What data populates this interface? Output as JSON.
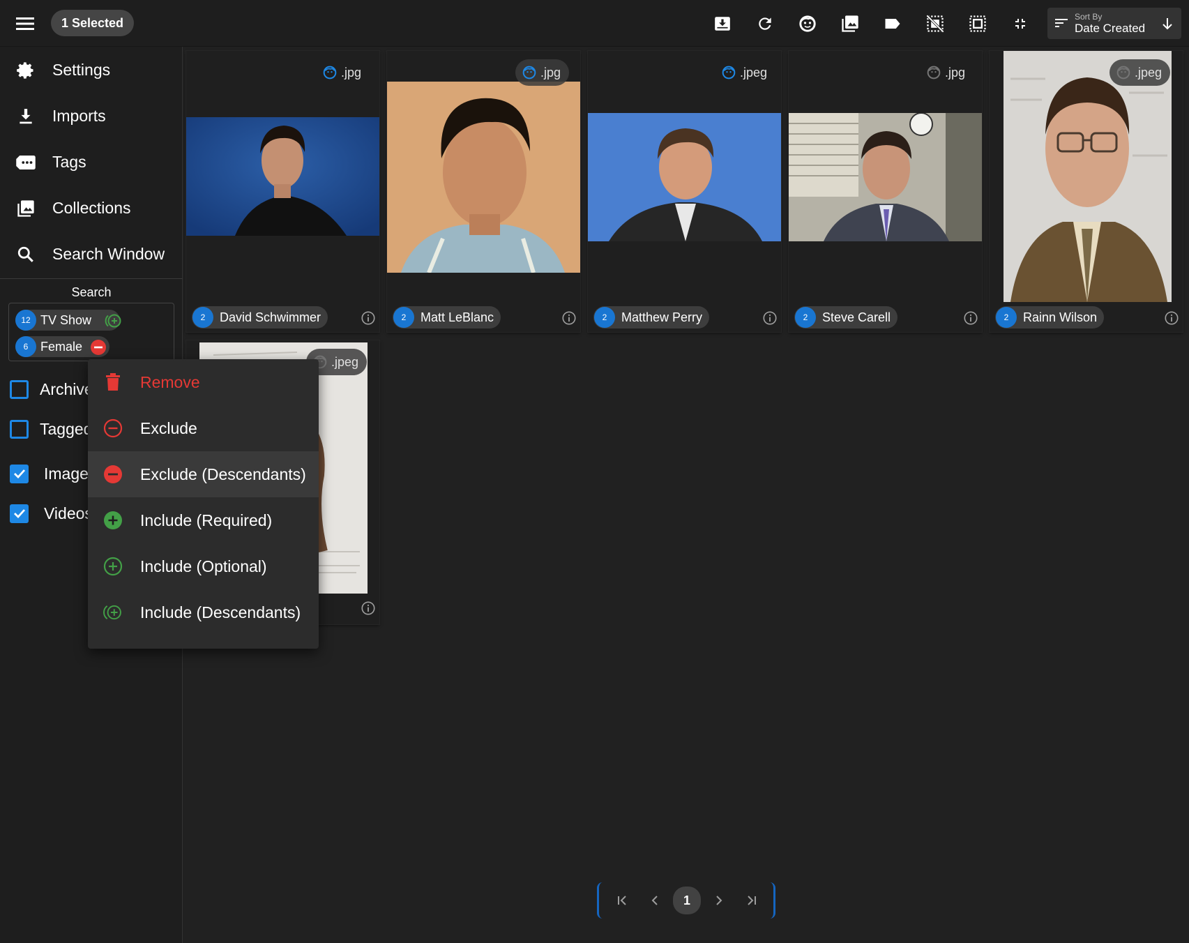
{
  "toolbar": {
    "selected_label": "1 Selected",
    "sort_label": "Sort By",
    "sort_value": "Date Created"
  },
  "sidebar": {
    "items": [
      {
        "label": "Settings",
        "icon": "gear-icon"
      },
      {
        "label": "Imports",
        "icon": "download-icon"
      },
      {
        "label": "Tags",
        "icon": "tag-icon"
      },
      {
        "label": "Collections",
        "icon": "collections-icon"
      },
      {
        "label": "Search Window",
        "icon": "search-icon"
      }
    ],
    "search_title": "Search",
    "search_tags": [
      {
        "count": "12",
        "name": "TV Show",
        "modifier": "include-descendants"
      },
      {
        "count": "6",
        "name": "Female",
        "modifier": "exclude-descendants"
      }
    ],
    "filters": [
      {
        "label": "Archive",
        "checked": false
      },
      {
        "label": "Tagged",
        "checked": false
      },
      {
        "label": "Images",
        "checked": true
      },
      {
        "label": "Videos",
        "checked": true
      }
    ]
  },
  "cards": [
    {
      "ext": ".jpg",
      "count": "2",
      "name": "David Schwimmer"
    },
    {
      "ext": ".jpg",
      "count": "2",
      "name": "Matt LeBlanc"
    },
    {
      "ext": ".jpeg",
      "count": "2",
      "name": "Matthew Perry"
    },
    {
      "ext": ".jpg",
      "count": "2",
      "name": "Steve Carell"
    },
    {
      "ext": ".jpeg",
      "count": "2",
      "name": "Rainn Wilson"
    },
    {
      "ext": ".jpeg",
      "count": "",
      "name": ""
    }
  ],
  "context_menu": {
    "items": [
      {
        "label": "Remove",
        "icon": "trash-icon"
      },
      {
        "label": "Exclude",
        "icon": "minus-circle-outline-icon"
      },
      {
        "label": "Exclude (Descendants)",
        "icon": "minus-circle-filled-icon"
      },
      {
        "label": "Include (Required)",
        "icon": "plus-circle-filled-icon"
      },
      {
        "label": "Include (Optional)",
        "icon": "plus-circle-outline-icon"
      },
      {
        "label": "Include (Descendants)",
        "icon": "plus-circle-descendants-icon"
      }
    ]
  },
  "pagination": {
    "current_page": "1"
  },
  "colors": {
    "accent": "#1976d2",
    "danger": "#e53935",
    "success": "#43a047",
    "background": "#212121"
  }
}
